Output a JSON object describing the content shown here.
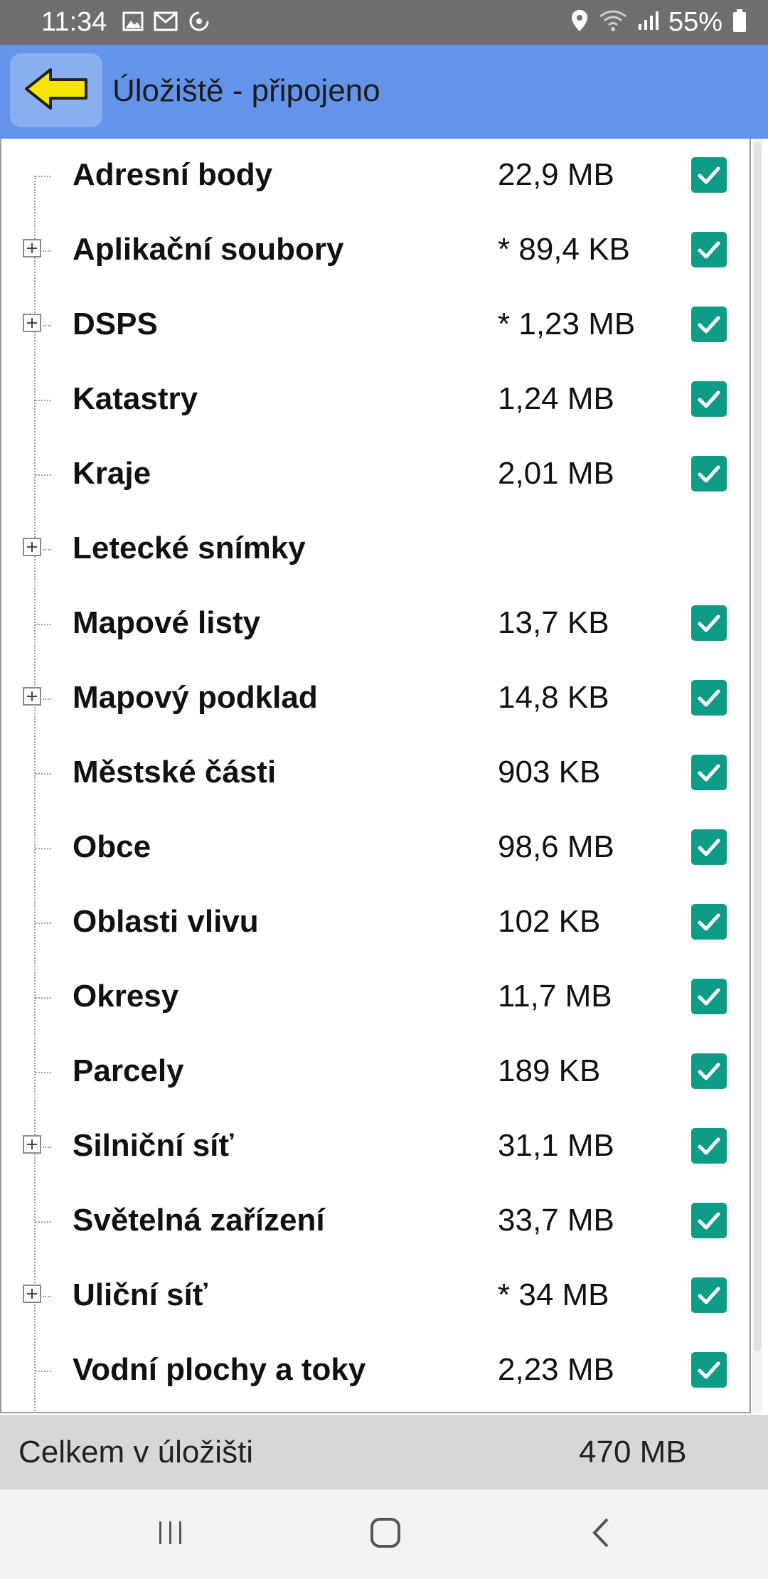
{
  "status_bar": {
    "time": "11:34",
    "battery": "55%",
    "icons_left": [
      "image-icon",
      "gmail-icon",
      "sync-icon"
    ],
    "icons_right": [
      "location-icon",
      "wifi-icon",
      "signal-icon",
      "battery-icon"
    ]
  },
  "app_bar": {
    "title": "Úložiště - připojeno",
    "back_icon": "arrow-left-icon"
  },
  "list": {
    "items": [
      {
        "label": "Adresní body",
        "size": "22,9 MB",
        "expandable": false,
        "checked": true
      },
      {
        "label": "Aplikační soubory",
        "size": "* 89,4 KB",
        "expandable": true,
        "checked": true
      },
      {
        "label": "DSPS",
        "size": "* 1,23 MB",
        "expandable": true,
        "checked": true
      },
      {
        "label": "Katastry",
        "size": "1,24 MB",
        "expandable": false,
        "checked": true
      },
      {
        "label": "Kraje",
        "size": "2,01 MB",
        "expandable": false,
        "checked": true
      },
      {
        "label": "Letecké snímky",
        "size": "",
        "expandable": true,
        "checked": false
      },
      {
        "label": "Mapové listy",
        "size": "13,7 KB",
        "expandable": false,
        "checked": true
      },
      {
        "label": "Mapový podklad",
        "size": "14,8 KB",
        "expandable": true,
        "checked": true
      },
      {
        "label": "Městské části",
        "size": "903 KB",
        "expandable": false,
        "checked": true
      },
      {
        "label": "Obce",
        "size": "98,6 MB",
        "expandable": false,
        "checked": true
      },
      {
        "label": "Oblasti vlivu",
        "size": "102 KB",
        "expandable": false,
        "checked": true
      },
      {
        "label": "Okresy",
        "size": "11,7 MB",
        "expandable": false,
        "checked": true
      },
      {
        "label": "Parcely",
        "size": "189 KB",
        "expandable": false,
        "checked": true
      },
      {
        "label": "Silniční síť",
        "size": "31,1 MB",
        "expandable": true,
        "checked": true
      },
      {
        "label": "Světelná zařízení",
        "size": "33,7 MB",
        "expandable": false,
        "checked": true
      },
      {
        "label": "Uliční síť",
        "size": "* 34 MB",
        "expandable": true,
        "checked": true
      },
      {
        "label": "Vodní plochy a toky",
        "size": "2,23 MB",
        "expandable": false,
        "checked": true
      }
    ]
  },
  "footer": {
    "label": "Celkem v úložišti",
    "total": "470 MB"
  },
  "nav_bar": {
    "buttons": [
      "recent-apps-icon",
      "home-icon",
      "back-icon"
    ]
  },
  "colors": {
    "app_bar": "#6494ea",
    "checkbox": "#0f9c86",
    "back_arrow": "#f5e500"
  }
}
